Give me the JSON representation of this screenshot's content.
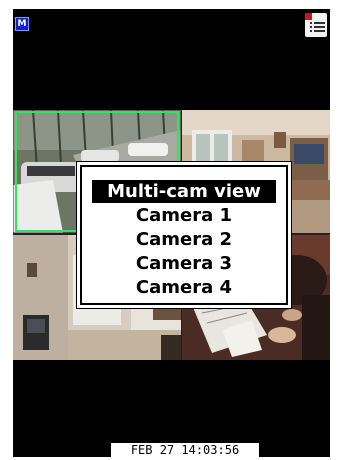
{
  "topbar": {
    "app_icon_letter": "M",
    "app_icon": "m-app-icon",
    "menu_icon": "list-menu-icon"
  },
  "cameras": [
    {
      "name": "Camera 1",
      "scene": "outdoor-driveway-cars"
    },
    {
      "name": "Camera 2",
      "scene": "living-room"
    },
    {
      "name": "Camera 3",
      "scene": "hallway-tv"
    },
    {
      "name": "Camera 4",
      "scene": "office-desk-person"
    }
  ],
  "menu": {
    "items": [
      "Multi-cam view",
      "Camera 1",
      "Camera 2",
      "Camera 3",
      "Camera 4"
    ],
    "selected_index": 0
  },
  "status": {
    "timestamp": "FEB 27 14:03:56"
  },
  "colors": {
    "selection_highlight": "#35e35a",
    "background": "#000000"
  }
}
